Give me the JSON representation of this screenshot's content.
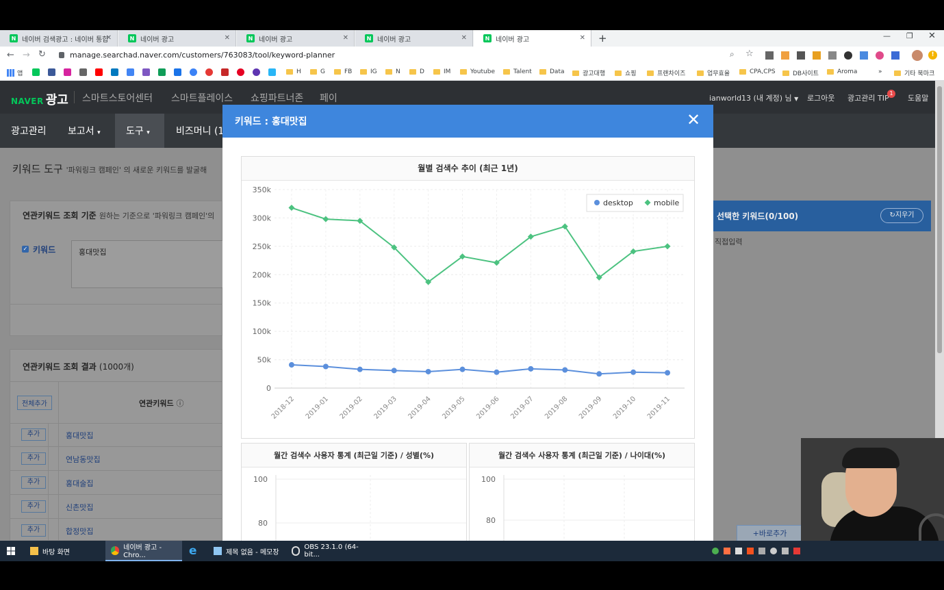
{
  "browser": {
    "tabs": [
      {
        "label": "네이버 검색광고 : 네이버 통합검색"
      },
      {
        "label": "네이버 광고"
      },
      {
        "label": "네이버 광고"
      },
      {
        "label": "네이버 광고"
      },
      {
        "label": "네이버 광고"
      }
    ],
    "url": "manage.searchad.naver.com/customers/763083/tool/keyword-planner",
    "bookmarks": [
      "앱",
      "H",
      "G",
      "FB",
      "IG",
      "N",
      "D",
      "IM",
      "Youtube",
      "Talent",
      "Data",
      "광고대행",
      "쇼핑",
      "프랜차이즈",
      "업무효율",
      "CPA,CPS",
      "DB사이트",
      "Aroma"
    ],
    "bookmarks_more": "»",
    "other_bookmarks": "기타 북마크"
  },
  "header": {
    "logo_naver": "NAVER",
    "logo_ad": "광고",
    "links": [
      "스마트스토어센터",
      "스마트플레이스",
      "쇼핑파트너존",
      "페이"
    ],
    "account": "ianworld13 (내 계정) 님",
    "logout": "로그아웃",
    "tip": "광고관리 TIP",
    "tip_badge": "1",
    "help": "도움말"
  },
  "nav": {
    "items": [
      "광고관리",
      "보고서",
      "도구",
      "비즈머니 (1"
    ]
  },
  "content": {
    "page_title": "키워드 도구",
    "page_sub": "'파워링크 캠페인' 의 새로운 키워드를 발굴해",
    "criteria_title": "연관키워드 조회 기준",
    "criteria_desc": "원하는 기준으로 '파워링크 캠페인'의",
    "keyword_label": "키워드",
    "keyword_value": "홍대맛집",
    "results_title": "연관키워드 조회 결과",
    "results_count": "(1000개)",
    "add_all": "전체추가",
    "col_keyword": "연관키워드",
    "add_label": "추가",
    "rows": [
      "홍대맛집",
      "연남동맛집",
      "홍대술집",
      "신촌맛집",
      "합정맛집"
    ],
    "selected_title": "선택한 키워드(0/100)",
    "clear_btn": "지우기",
    "direct_input": "직접입력",
    "quick_add": "바로추가"
  },
  "modal": {
    "title": "키워드 : 홍대맛집",
    "chart_title": "월별 검색수 추이 (최근 1년)",
    "gender_title": "월간 검색수 사용자 통계 (최근일 기준) / 성별(%)",
    "age_title": "월간 검색수 사용자 통계 (최근일 기준) / 나이대(%)",
    "gender_ticks": [
      "100",
      "80"
    ],
    "age_ticks": [
      "100",
      "80"
    ]
  },
  "chart_data": {
    "type": "line",
    "title": "월별 검색수 추이 (최근 1년)",
    "x": [
      "2018-12",
      "2019-01",
      "2019-02",
      "2019-03",
      "2019-04",
      "2019-05",
      "2019-06",
      "2019-07",
      "2019-08",
      "2019-09",
      "2019-10",
      "2019-11"
    ],
    "yticks": [
      "0",
      "50k",
      "100k",
      "150k",
      "200k",
      "250k",
      "300k",
      "350k"
    ],
    "ylim": [
      0,
      350000
    ],
    "series": [
      {
        "name": "desktop",
        "color": "#5b8fdc",
        "values": [
          41000,
          38000,
          33000,
          31000,
          29000,
          33000,
          28000,
          34000,
          32000,
          25000,
          28000,
          27000
        ]
      },
      {
        "name": "mobile",
        "color": "#4cc280",
        "values": [
          318000,
          298000,
          295000,
          248000,
          187000,
          232000,
          221000,
          267000,
          285000,
          195000,
          241000,
          250000
        ]
      }
    ],
    "legend": "top-right",
    "grid": true
  },
  "taskbar": {
    "items": [
      "바탕 화면",
      "네이버 광고 - Chro...",
      "제목 없음 - 메모장",
      "OBS 23.1.0 (64-bit..."
    ]
  }
}
